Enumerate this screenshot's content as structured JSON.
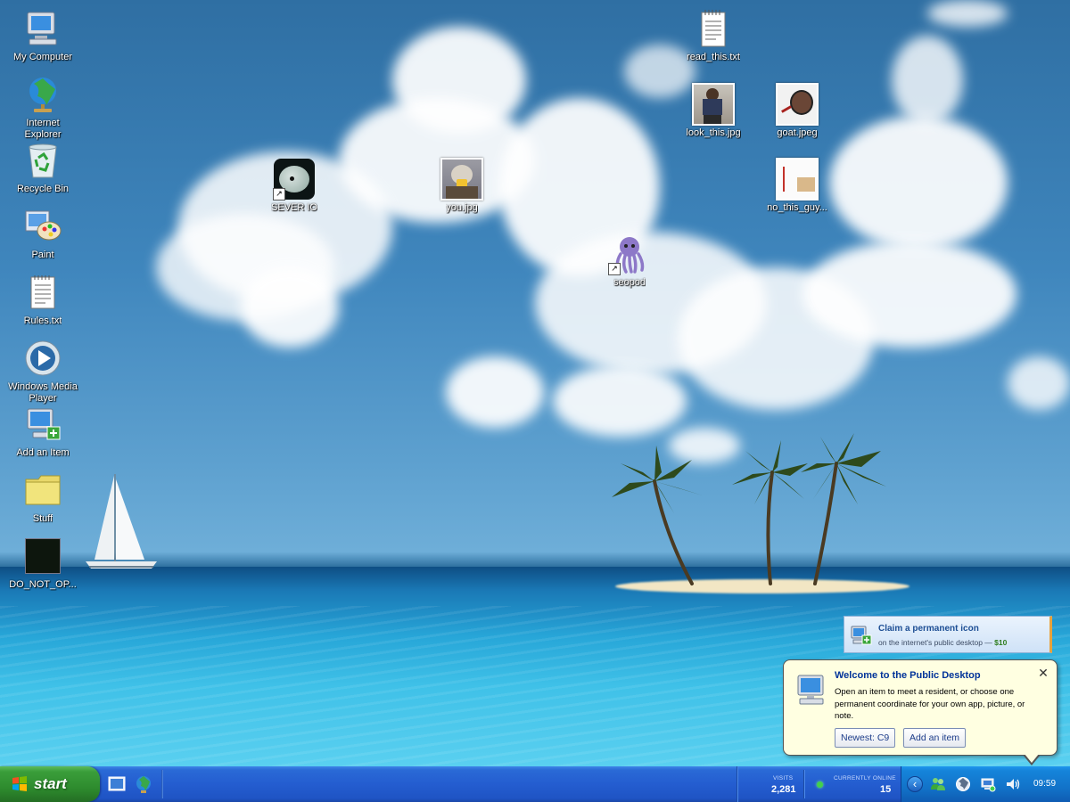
{
  "desktop": {
    "left_icons": [
      {
        "label": "My Computer"
      },
      {
        "label": "Internet Explorer"
      },
      {
        "label": "Recycle Bin"
      },
      {
        "label": "Paint"
      },
      {
        "label": "Rules.txt"
      },
      {
        "label": "Windows Media Player"
      },
      {
        "label": "Add an Item"
      },
      {
        "label": "Stuff"
      },
      {
        "label": "DO_NOT_OP..."
      }
    ],
    "items": [
      {
        "label": "read_this.txt"
      },
      {
        "label": "look_this.jpg"
      },
      {
        "label": "goat.jpeg"
      },
      {
        "label": "SEVER IO"
      },
      {
        "label": "you.jpg"
      },
      {
        "label": "no_this_guy..."
      },
      {
        "label": "seopod"
      }
    ]
  },
  "promo": {
    "title": "Claim a permanent icon",
    "subtitle": "on the internet's public desktop — ",
    "price": "$10"
  },
  "balloon": {
    "title": "Welcome to the Public Desktop",
    "body": "Open an item to meet a resident, or choose one permanent coordinate for your own app, picture, or note.",
    "close": "✕",
    "newest_button": "Newest: C9",
    "add_button": "Add an item"
  },
  "taskbar": {
    "start_label": "start",
    "visits_label": "VISITS",
    "visits_value": "2,281",
    "online_label": "CURRENTLY ONLINE",
    "online_value": "15",
    "tray_arrow": "‹",
    "clock": "09:59"
  },
  "icons": {
    "start": "windows-flag-icon",
    "quick_launch": [
      "show-desktop-icon",
      "internet-explorer-icon"
    ],
    "tray": [
      "users-icon",
      "globe-icon",
      "network-icon",
      "volume-icon"
    ]
  },
  "colors": {
    "taskbar_blue": "#245dd0",
    "start_green": "#3a9e3a",
    "balloon_bg": "#ffffe1",
    "tray_blue": "#1273c9",
    "online_green": "#43d04a"
  }
}
